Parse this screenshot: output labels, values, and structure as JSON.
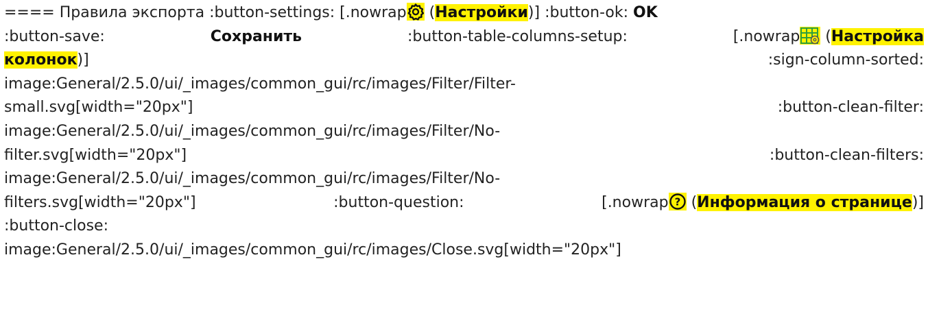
{
  "intro": "==== Правила экспорта",
  "settings": {
    "key": ":button-settings:",
    "prefix": "[.nowrap",
    "label": "Настройки",
    "suffix": "]",
    "icon": "gear-icon"
  },
  "ok": {
    "key": ":button-ok:",
    "label": "OK"
  },
  "save": {
    "key": ":button-save:",
    "label": "Сохранить"
  },
  "columns": {
    "key": ":button-table-columns-setup:",
    "prefix": "[.nowrap",
    "label_part1": "Настройка",
    "label_part2": "колонок",
    "suffix": "]",
    "icon": "table-settings-icon"
  },
  "sorted": {
    "key": ":sign-column-sorted:",
    "path_part1": "image:General/2.5.0/ui/_images/common_gui/rc/images/Filter/Filter-",
    "path_part2": "small.svg[width=\"20px\"]"
  },
  "clean_filter": {
    "key": ":button-clean-filter:",
    "path_part1": "image:General/2.5.0/ui/_images/common_gui/rc/images/Filter/No-",
    "path_part2": "filter.svg[width=\"20px\"]"
  },
  "clean_filters": {
    "key": ":button-clean-filters:",
    "path_part1": "image:General/2.5.0/ui/_images/common_gui/rc/images/Filter/No-",
    "path_part2": "filters.svg[width=\"20px\"]"
  },
  "question": {
    "key": ":button-question:",
    "prefix": "[.nowrap",
    "label": "Информация о странице",
    "suffix": "]",
    "icon": "question-circle-icon"
  },
  "close": {
    "key": ":button-close:",
    "path": "image:General/2.5.0/ui/_images/common_gui/rc/images/Close.svg[width=\"20px\"]"
  },
  "colors": {
    "highlight": "#fff200",
    "text": "#222222"
  }
}
